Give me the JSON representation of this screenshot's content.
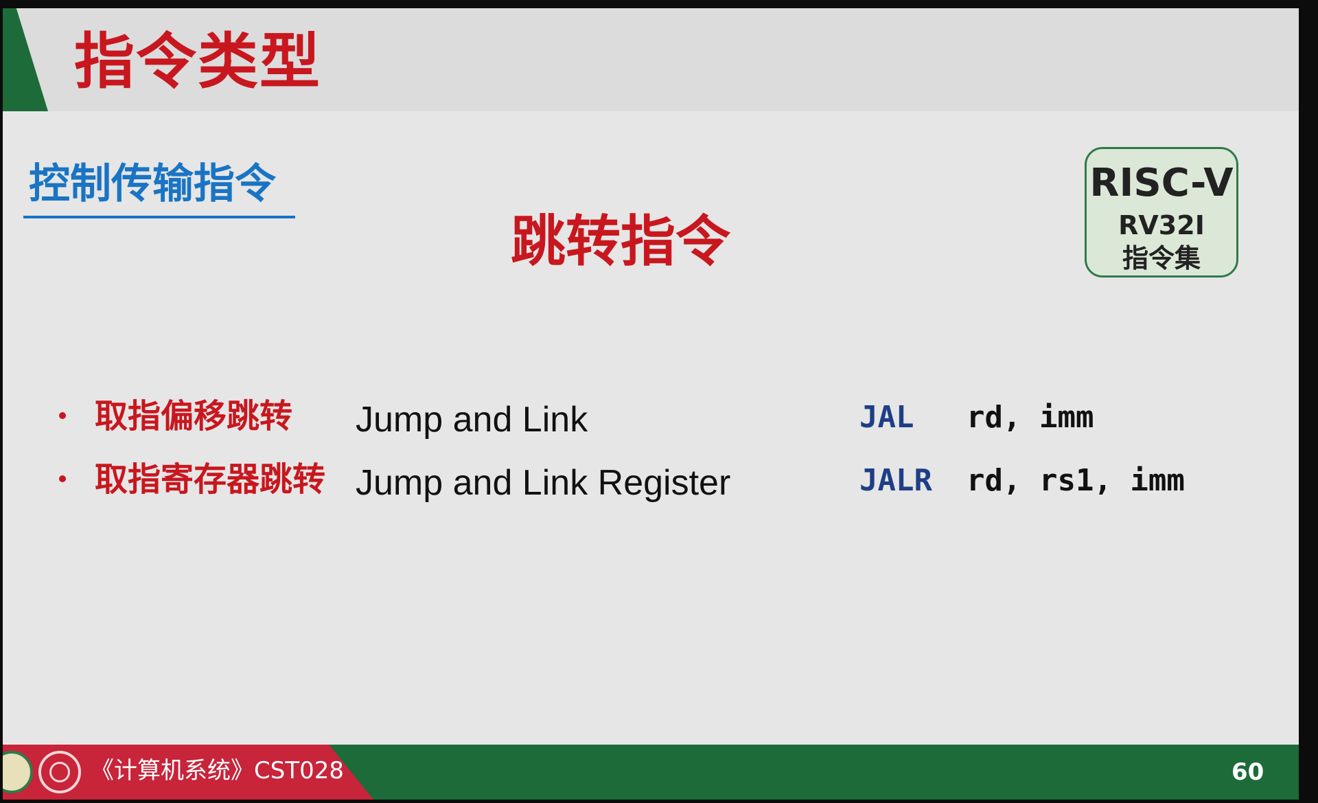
{
  "slide": {
    "title": "指令类型",
    "section_title": "控制传输指令",
    "subtitle": "跳转指令",
    "badge": {
      "line1": "RISC-V",
      "line2": "RV32I",
      "line3": "指令集"
    },
    "instructions": [
      {
        "cn_name": "取指偏移跳转",
        "en_name": "Jump and Link",
        "opcode": "JAL",
        "operands": "rd, imm"
      },
      {
        "cn_name": "取指寄存器跳转",
        "en_name": "Jump and Link Register",
        "opcode": "JALR",
        "operands": "rd, rs1, imm"
      }
    ]
  },
  "footer": {
    "course": "《计算机系统》CST028",
    "page_number": "60"
  },
  "colors": {
    "title_red": "#c8171e",
    "section_blue": "#1a74c4",
    "brand_green": "#1e6b3a",
    "footer_red": "#c8243a",
    "opcode_blue": "#1e3f86"
  }
}
